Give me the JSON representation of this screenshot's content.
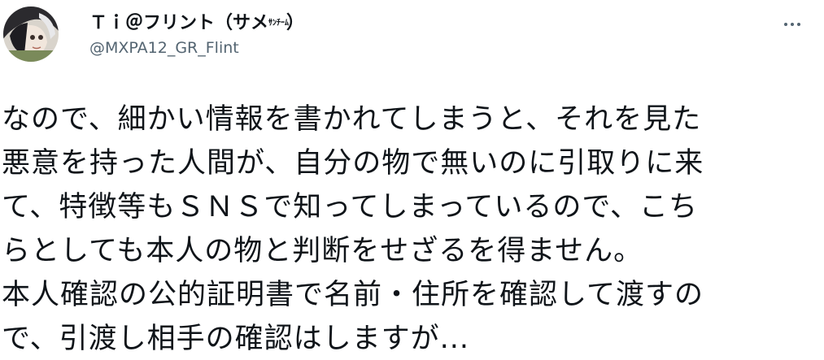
{
  "author": {
    "display_name": "Ｔｉ＠フリント（サメ",
    "display_name_small": "ｻﾝﾁｰﾑ",
    "display_name_close": "）",
    "handle": "@MXPA12_GR_Flint"
  },
  "more_icon": "ellipsis-icon",
  "tweet": {
    "lines": [
      "なので、細かい情報を書かれてしまうと、それを見た",
      "悪意を持った人間が、自分の物で無いのに引取りに来",
      "て、特徴等もＳＮＳで知ってしまっているので、こち",
      "らとしても本人の物と判断をせざるを得ません。",
      "本人確認の公的証明書で名前・住所を確認して渡すの",
      "で、引渡し相手の確認はしますが..."
    ]
  },
  "colors": {
    "text": "#0f1419",
    "secondary": "#536471"
  }
}
